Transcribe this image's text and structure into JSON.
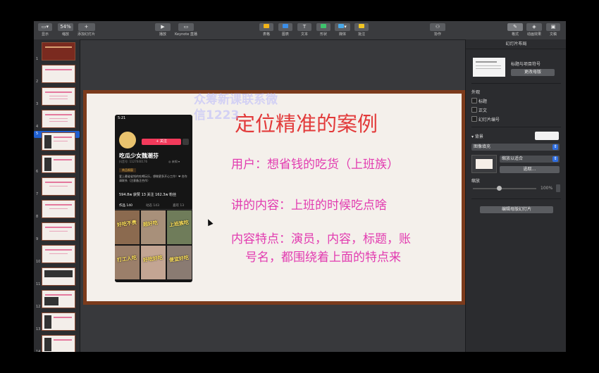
{
  "toolbar": {
    "view": "显示",
    "zoom_value": "54%",
    "zoom_label": "缩放",
    "add_slide": "添加幻灯片",
    "play": "播放",
    "keynote_live": "Keynote 直播",
    "table": "表格",
    "chart": "图表",
    "text": "文本",
    "shape": "形状",
    "media": "媒体",
    "comment": "批注",
    "collaborate": "协作",
    "format": "格式",
    "animate": "动画效果",
    "document": "文稿"
  },
  "thumbnails": [
    "1",
    "2",
    "3",
    "4",
    "5",
    "6",
    "7",
    "8",
    "9",
    "10",
    "11",
    "12",
    "13",
    "14"
  ],
  "slide": {
    "title": "定位精准的案例",
    "line1": "用户：想省钱的吃货（上班族）",
    "line2": "讲的内容：上班的时候吃点啥",
    "line3a": "内容特点：演员，内容，标题，账",
    "line3b": "号名，都围绕着上面的特点来",
    "watermark1": "众筹新课联系微",
    "watermark2": "信1223"
  },
  "phone": {
    "status": "5:21",
    "follow": "+ 关注",
    "name": "吃瓜少女魏潮芬",
    "uid": "抖音号: 1127040176",
    "fav": "◎ 未知 ▾",
    "tag": "商品橱窗",
    "bio": "爱上最省省钱的吃喝玩乐，想做更多开心工作！❤ 合作请联系（注意备注合作）",
    "stats": "594.8w 获赞   13 关注   162.3w 粉丝",
    "tab1": "作品 140",
    "tab2": "动态 143",
    "tab3": "喜欢 13",
    "captions": [
      "好吃不贵",
      "超好吃",
      "上班族吃",
      "打工人吃",
      "好吃好吃",
      "便宜好吃"
    ]
  },
  "inspector": {
    "header": "幻灯片布局",
    "layout_name": "标题与项目符号",
    "change_master": "更改母版",
    "appearance": "外观",
    "opt_title": "标题",
    "opt_body": "正文",
    "opt_slide_number": "幻灯片编号",
    "background": "背景",
    "fill_type": "图像填充",
    "scale_fit": "缩放以适合",
    "choose": "选取...",
    "scale_label": "缩放",
    "scale_value": "100%",
    "edit_master": "编辑母版幻灯片"
  },
  "colors": {
    "title": "#e23a3a",
    "body": "#e23bb0",
    "selection": "#1f5fcf",
    "slide_border": "#7c3b1c"
  }
}
